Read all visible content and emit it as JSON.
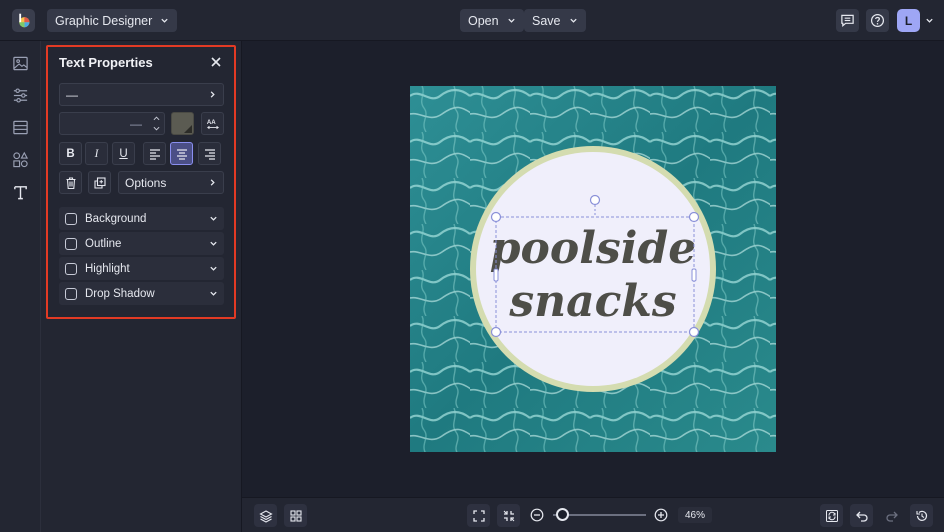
{
  "app": {
    "mode_label": "Graphic Designer",
    "open_label": "Open",
    "save_label": "Save",
    "user_initial": "L"
  },
  "rail": {
    "items": [
      "image-icon",
      "sliders-icon",
      "layout-icon",
      "shapes-icon",
      "text-icon"
    ]
  },
  "text_properties": {
    "title": "Text Properties",
    "font_value": "—",
    "size_value": "—",
    "color": "#5b5b52",
    "options_label": "Options",
    "formatting": {
      "bold": "B",
      "italic": "I",
      "underline": "U"
    },
    "alignment_selected": "center",
    "effects": [
      {
        "label": "Background",
        "checked": false
      },
      {
        "label": "Outline",
        "checked": false
      },
      {
        "label": "Highlight",
        "checked": false
      },
      {
        "label": "Drop Shadow",
        "checked": false
      }
    ]
  },
  "canvas": {
    "text_line_1": "poolside",
    "text_line_2": "snacks",
    "circle_fill": "#f0effb",
    "circle_border": "#d4dcb0",
    "text_color": "#4e4e48",
    "background": "pool water photo"
  },
  "zoom": {
    "value": "46%",
    "level": 0.46
  }
}
